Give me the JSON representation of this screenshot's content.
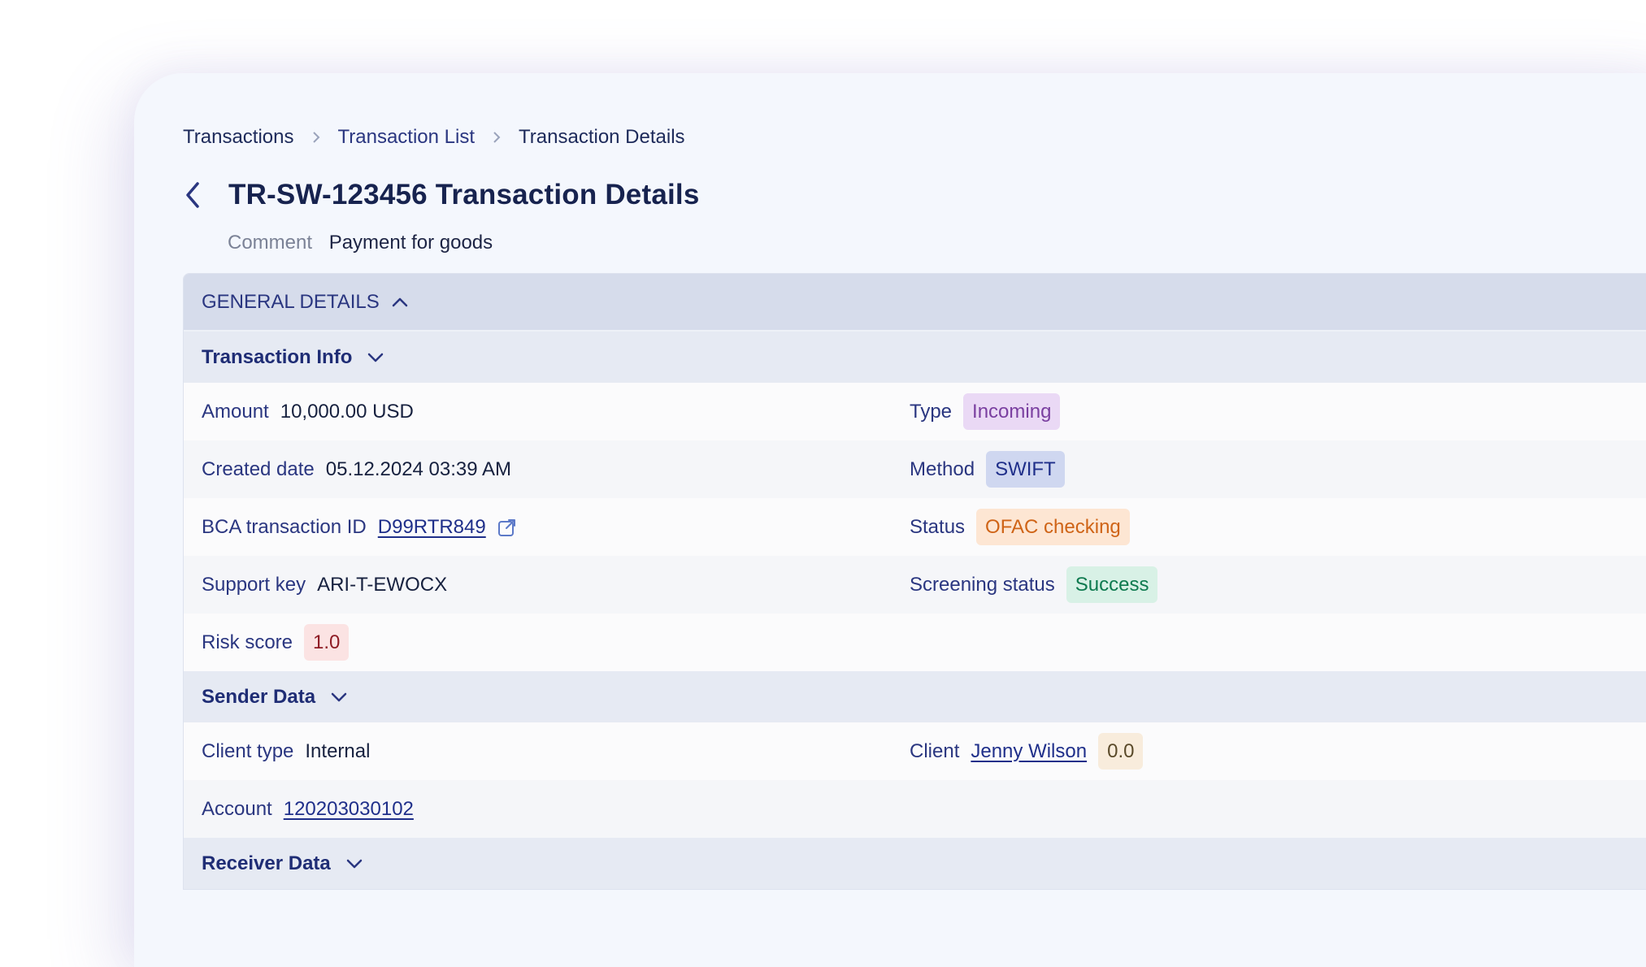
{
  "breadcrumb": {
    "items": [
      "Transactions",
      "Transaction List",
      "Transaction Details"
    ]
  },
  "header": {
    "title": "TR-SW-123456 Transaction Details",
    "comment_label": "Comment",
    "comment_value": "Payment for goods"
  },
  "panel": {
    "title": "GENERAL DETAILS",
    "sections": {
      "transaction_info": {
        "title": "Transaction Info",
        "amount": {
          "label": "Amount",
          "value": "10,000.00 USD"
        },
        "type": {
          "label": "Type",
          "value": "Incoming"
        },
        "created_date": {
          "label": "Created date",
          "value": "05.12.2024 03:39 AM"
        },
        "method": {
          "label": "Method",
          "value": "SWIFT"
        },
        "bca_id": {
          "label": "BCA transaction ID",
          "value": "D99RTR849"
        },
        "status": {
          "label": "Status",
          "value": "OFAC checking"
        },
        "support_key": {
          "label": "Support key",
          "value": "ARI-T-EWOCX"
        },
        "screening_status": {
          "label": "Screening status",
          "value": "Success"
        },
        "risk_score": {
          "label": "Risk score",
          "value": "1.0"
        }
      },
      "sender_data": {
        "title": "Sender Data",
        "client_type": {
          "label": "Client type",
          "value": "Internal"
        },
        "client": {
          "label": "Client",
          "value": "Jenny Wilson",
          "score": "0.0"
        },
        "account": {
          "label": "Account",
          "value": "120203030102"
        }
      },
      "receiver_data": {
        "title": "Receiver Data"
      }
    }
  },
  "colors": {
    "accent": "#1f2f8a",
    "header_bg": "#d6dceb",
    "section_bg": "#e6eaf3"
  },
  "icons": {
    "back": "chevron-left-icon",
    "breadcrumb_sep": "chevron-right-icon",
    "collapse": "chevron-up-icon",
    "expand": "chevron-down-icon",
    "external": "external-link-icon"
  }
}
